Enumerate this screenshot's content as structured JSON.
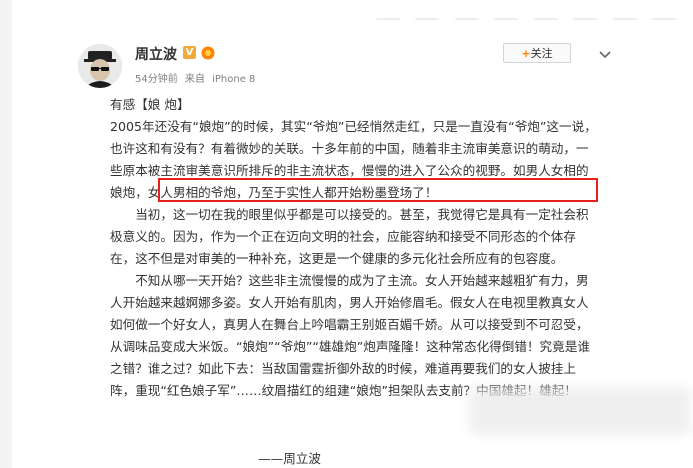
{
  "post": {
    "author": "周立波",
    "verified_badge": "V",
    "timestamp": "54分钟前",
    "source_prefix": "来自",
    "source_device": "iPhone 8",
    "follow_label": "关注",
    "follow_plus": "+",
    "title": "有感【娘  炮】",
    "paragraph1": "2005年还没有“娘炮”的时候，其实“爷炮”已经悄然走红，只是一直没有“爷炮”这一说，也许这和有没有？有着微妙的关联。十多年前的中国，随着非主流审美意识的萌动，一些原本被主流审美意识所排斥的非主流状态，慢慢的进入了公众的视野。如男人女相的娘炮，女人男相的爷炮，乃至于实性人都开始粉墨登场了！",
    "paragraph2": "当初，这一切在我的眼里似乎都是可以接受的。甚至，我觉得它是具有一定社会积极意义的。因为，作为一个正在迈向文明的社会，应能容纳和接受不同形态的个体存在，这不但是对审美的一种补充，这更是一个健康的多元化社会所应有的包容度。",
    "paragraph3": "不知从哪一天开始？这些非主流慢慢的成为了主流。女人开始越来越粗犷有力，男人开始越来越婀娜多姿。女人开始有肌肉，男人开始修眉毛。假女人在电视里教真女人如何做一个好女人，真男人在舞台上吟唱霸王别姬百媚千娇。从可以接受到不可忍受，从调味品变成大米饭。“娘炮”“爷炮”“雄雄炮”炮声隆隆！这种常态化得倒错！究竟是谁之错？谁之过？如此下去：当敌国雷霆折御外敌的时候，难道再要我们的女人披挂上阵，重现“红色娘子军”……纹眉描红的组建“娘炮”担架队去支前？中国雄起！雄起！",
    "signature": "——周立波"
  },
  "colors": {
    "accent": "#ff8200",
    "badge": "#f2a93b",
    "highlight": "#e6211c",
    "meta": "#808080"
  },
  "icons": {
    "avatar": "avatar",
    "verified": "verified-icon",
    "vip": "vip-icon",
    "menu": "chevron-down-icon"
  }
}
